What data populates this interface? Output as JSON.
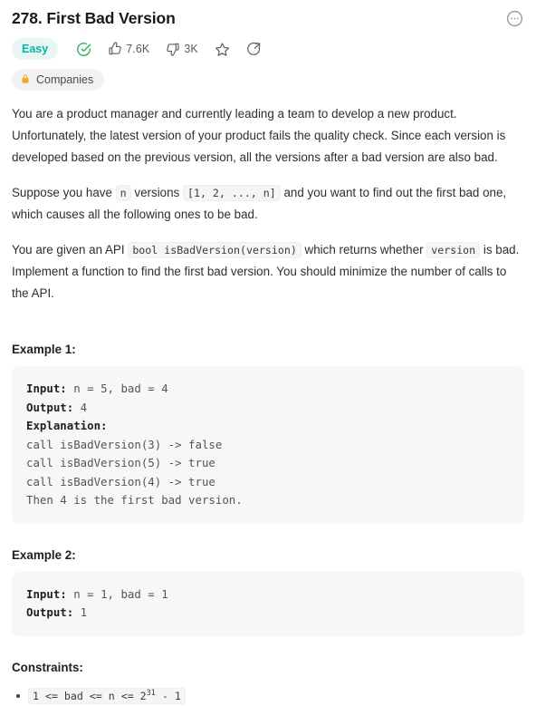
{
  "header": {
    "title": "278. First Bad Version",
    "more_icon": "more-options-circle-icon",
    "difficulty": "Easy",
    "solved_icon": "check-circle-icon",
    "likes": "7.6K",
    "dislikes": "3K",
    "star_icon": "star-icon",
    "share_icon": "share-icon",
    "companies_label": "Companies",
    "lock_icon": "lock-icon"
  },
  "colors": {
    "difficulty_text": "#0ab3a3",
    "difficulty_bg": "#e7f8f4",
    "solved_green": "#2db55d",
    "lock_orange": "#f5a623",
    "code_block_bg": "#f7f7f7",
    "inline_code_bg": "#f5f5f5",
    "body_text": "#2e2e2e"
  },
  "description": {
    "paragraph1": "You are a product manager and currently leading a team to develop a new product. Unfortunately, the latest version of your product fails the quality check. Since each version is developed based on the previous version, all the versions after a bad version are also bad.",
    "paragraph2_part1": "Suppose you have",
    "paragraph2_code1": "n",
    "paragraph2_part2": "versions",
    "paragraph2_code2": "[1, 2, ..., n]",
    "paragraph2_part3": "and you want to find out the first bad one, which causes all the following ones to be bad.",
    "paragraph3_part1": "You are given an API",
    "paragraph3_code1": "bool isBadVersion(version)",
    "paragraph3_part2": "which returns whether",
    "paragraph3_code2": "version",
    "paragraph3_part3": "is bad. Implement a function to find the first bad version. You should minimize the number of calls to the API."
  },
  "examples": [
    {
      "heading": "Example 1:",
      "input_label": "Input:",
      "input_value": " n = 5, bad = 4",
      "output_label": "Output:",
      "output_value": " 4",
      "explanation_label": "Explanation:",
      "explanation_lines": "call isBadVersion(3) -> false\ncall isBadVersion(5) -> true\ncall isBadVersion(4) -> true\nThen 4 is the first bad version."
    },
    {
      "heading": "Example 2:",
      "input_label": "Input:",
      "input_value": " n = 1, bad = 1",
      "output_label": "Output:",
      "output_value": " 1",
      "explanation_label": "",
      "explanation_lines": ""
    }
  ],
  "constraints": {
    "heading": "Constraints:",
    "items": [
      {
        "prefix": "1 <= bad <= n <= 2",
        "superscript": "31",
        "suffix": " - 1"
      }
    ]
  }
}
